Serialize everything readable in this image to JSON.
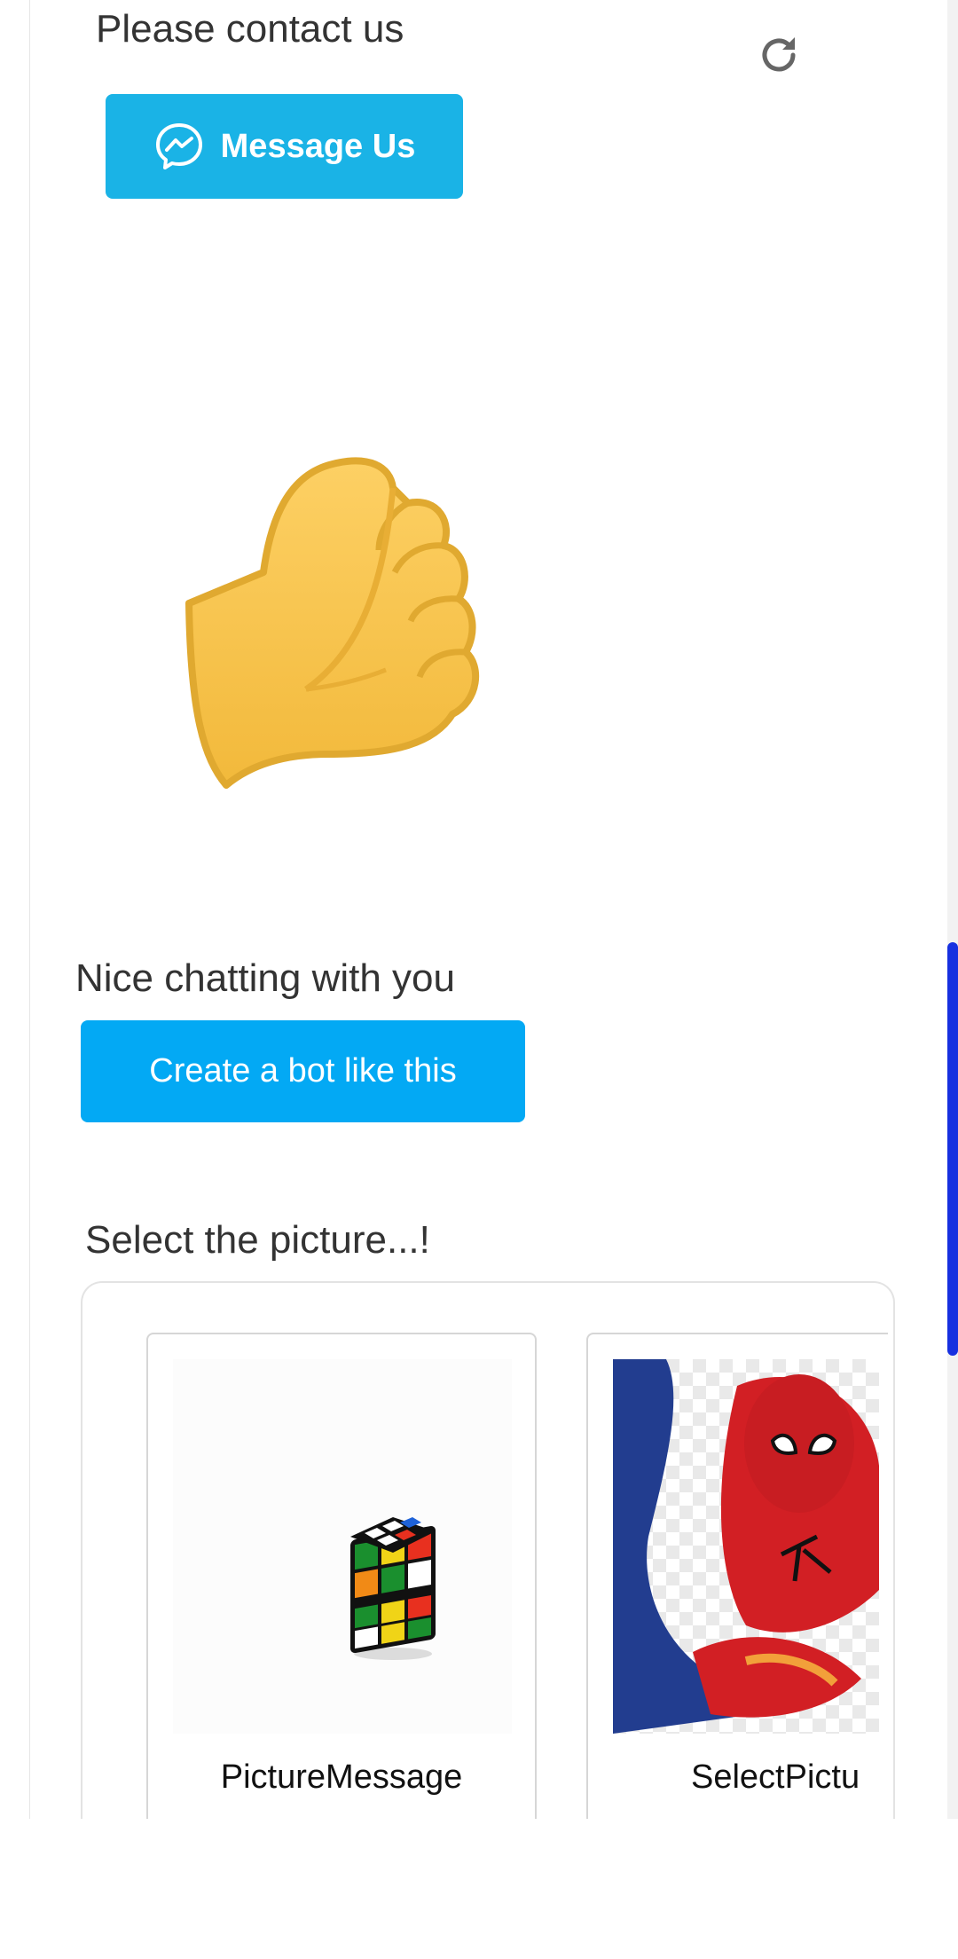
{
  "contact": {
    "text": "Please contact us",
    "button_label": "Message Us",
    "button_color": "#1ab3e6"
  },
  "closing": {
    "text": "Nice chatting with you",
    "button_label": "Create a bot like this",
    "button_color": "#03a9f4"
  },
  "picture_select": {
    "prompt": "Select the picture...!",
    "cards": [
      {
        "caption": "PictureMessage",
        "image": "rubiks-cube"
      },
      {
        "caption": "SelectPictu",
        "image": "spider-man"
      }
    ]
  },
  "icons": {
    "refresh": "refresh-icon",
    "messenger": "messenger-icon",
    "fist": "fist-emoji"
  },
  "scrollbar_color": "#1730e0"
}
